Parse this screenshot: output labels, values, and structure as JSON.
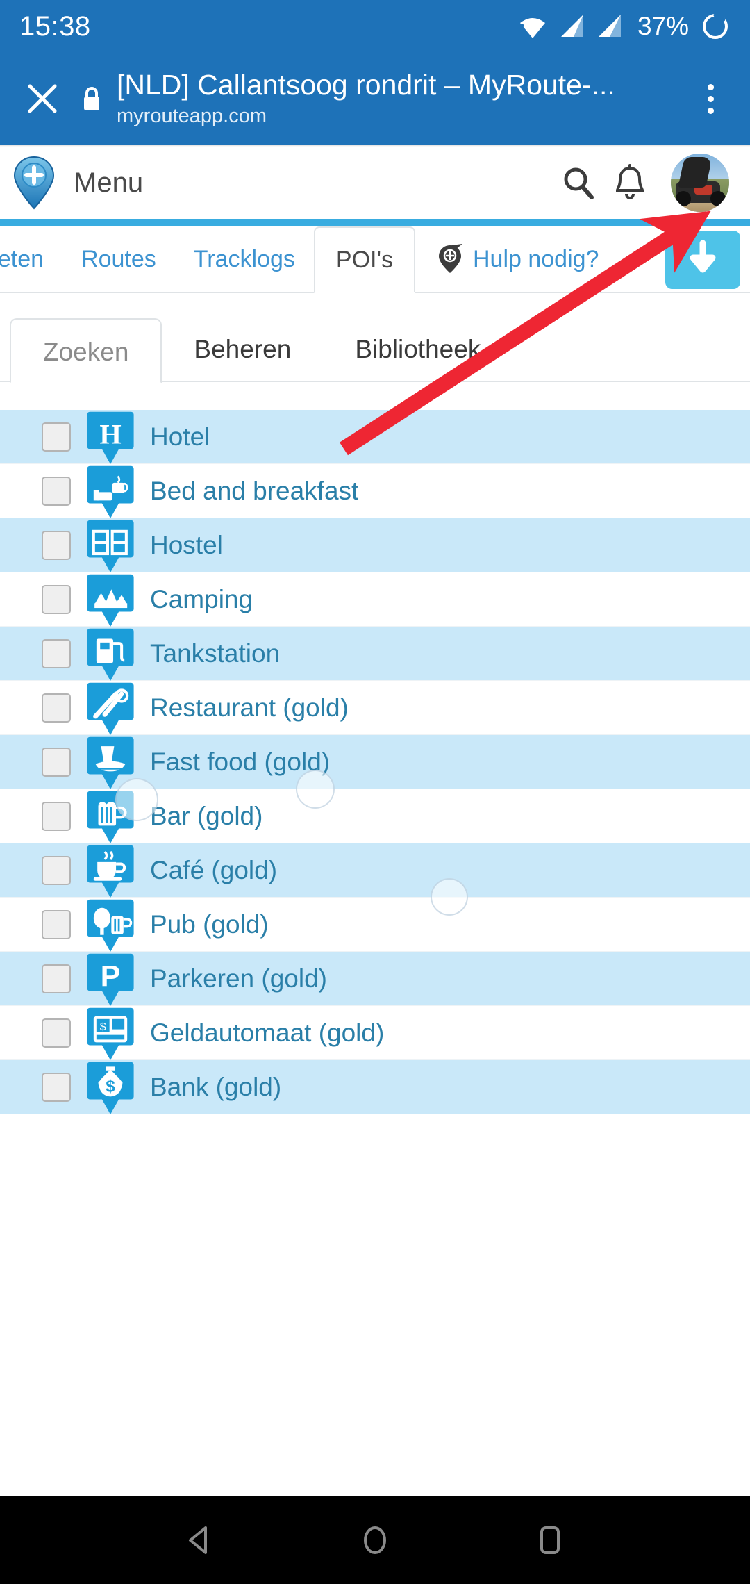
{
  "statusbar": {
    "time": "15:38",
    "battery": "37%",
    "icons": [
      "wifi-icon",
      "signal-icon",
      "signal-icon",
      "battery-charging-icon"
    ]
  },
  "browser": {
    "close_label": "close-icon",
    "lock_label": "lock-icon",
    "title": "[NLD] Callantsoog rondrit – MyRoute-...",
    "url": "myrouteapp.com",
    "menu_label": "overflow-menu-icon"
  },
  "site_header": {
    "brand": "myroute-pin-logo",
    "menu_label": "Menu",
    "search_icon": "search-icon",
    "bell_icon": "notification-bell-icon",
    "avatar": "user-avatar"
  },
  "main_tabs": [
    {
      "label": "rieten",
      "active": false
    },
    {
      "label": "Routes",
      "active": false
    },
    {
      "label": "Tracklogs",
      "active": false
    },
    {
      "label": "POI's",
      "active": true
    }
  ],
  "help_tab": {
    "label": "Hulp nodig?",
    "icon": "help-pin-icon"
  },
  "download_button": {
    "icon": "download-arrow-icon",
    "color": "#4ec3e8"
  },
  "sub_tabs": [
    {
      "label": "Zoeken",
      "active": true
    },
    {
      "label": "Beheren",
      "active": false
    },
    {
      "label": "Bibliotheek",
      "active": false
    }
  ],
  "poi_items": [
    {
      "label": "Hotel",
      "icon": "hotel-pin-icon",
      "checked": false
    },
    {
      "label": "Bed and breakfast",
      "icon": "bnb-pin-icon",
      "checked": false
    },
    {
      "label": "Hostel",
      "icon": "hostel-pin-icon",
      "checked": false
    },
    {
      "label": "Camping",
      "icon": "camping-pin-icon",
      "checked": false
    },
    {
      "label": "Tankstation",
      "icon": "fuel-pin-icon",
      "checked": false
    },
    {
      "label": "Restaurant (gold)",
      "icon": "restaurant-pin-icon",
      "checked": false
    },
    {
      "label": "Fast food (gold)",
      "icon": "fastfood-pin-icon",
      "checked": false
    },
    {
      "label": "Bar (gold)",
      "icon": "bar-pin-icon",
      "checked": false
    },
    {
      "label": "Café (gold)",
      "icon": "cafe-pin-icon",
      "checked": false
    },
    {
      "label": "Pub (gold)",
      "icon": "pub-pin-icon",
      "checked": false
    },
    {
      "label": "Parkeren (gold)",
      "icon": "parking-pin-icon",
      "checked": false
    },
    {
      "label": "Geldautomaat (gold)",
      "icon": "atm-pin-icon",
      "checked": false
    },
    {
      "label": "Bank (gold)",
      "icon": "bank-pin-icon",
      "checked": false
    }
  ],
  "annotation": {
    "type": "arrow",
    "color": "#ee2633",
    "points_to": "download-button"
  },
  "navbar": {
    "back": "back-triangle-icon",
    "home": "home-circle-icon",
    "recents": "recents-square-icon"
  },
  "colors": {
    "chrome_blue": "#1e72b8",
    "brand_blue": "#39ace0",
    "row_alt": "#c9e8f9",
    "link_blue": "#2a7fa8",
    "pin_blue": "#1b9dd9"
  }
}
